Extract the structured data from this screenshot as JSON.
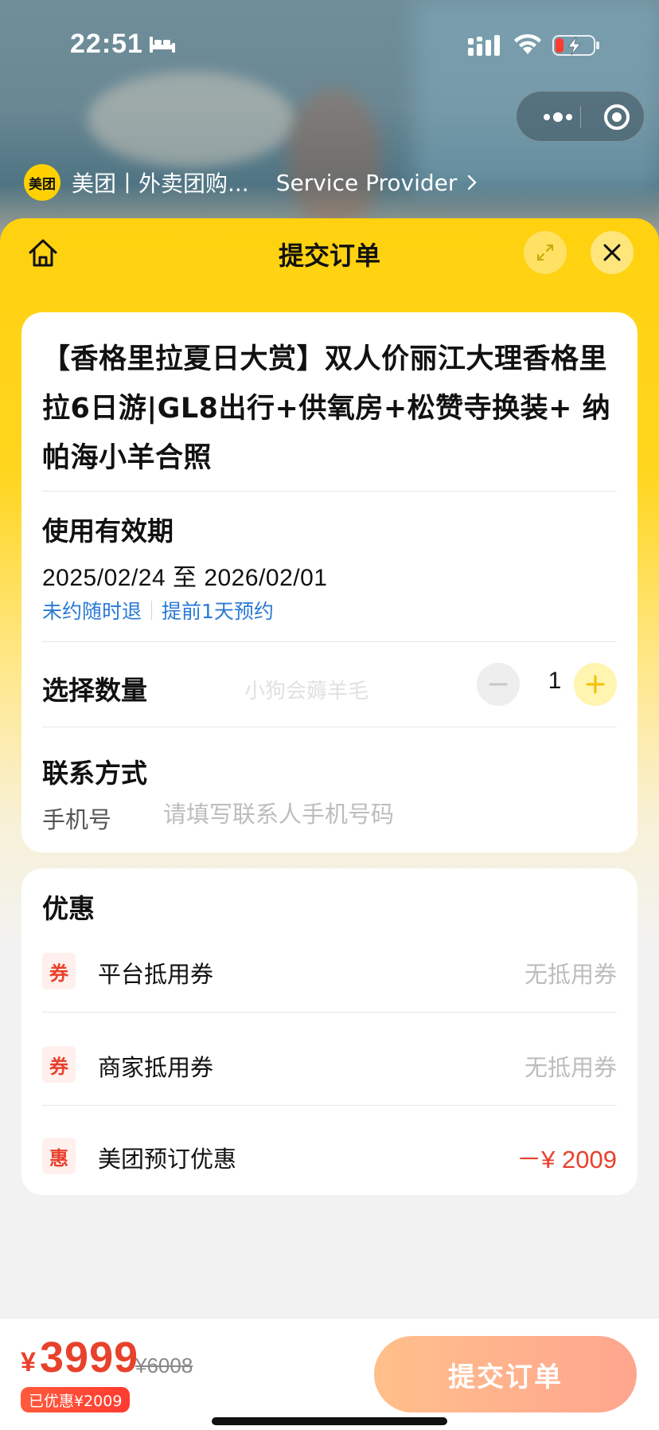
{
  "status_bar": {
    "time": "22:51"
  },
  "mini_program": {
    "logo_text": "美团",
    "name": "美团丨外卖团购...",
    "provider": "Service Provider"
  },
  "sheet": {
    "title": "提交订单"
  },
  "product": {
    "title": "【香格里拉夏日大赏】双人价丽江大理香格里拉6日游|GL8出行+供氧房+松赞寺换装+ 纳帕海小羊合照"
  },
  "validity": {
    "label": "使用有效期",
    "range": "2025/02/24 至 2026/02/01",
    "policy_refund": "未约随时退",
    "policy_booking": "提前1天预约"
  },
  "quantity": {
    "label": "选择数量",
    "value": "1",
    "watermark": "小狗会薅羊毛"
  },
  "contact": {
    "label": "联系方式",
    "phone_label": "手机号",
    "phone_value": "",
    "phone_placeholder": "请填写联系人手机号码"
  },
  "promotions": {
    "title": "优惠",
    "items": [
      {
        "badge": "券",
        "label": "平台抵用券",
        "value": "无抵用券"
      },
      {
        "badge": "券",
        "label": "商家抵用券",
        "value": "无抵用券"
      },
      {
        "badge": "惠",
        "label": "美团预订优惠",
        "value": "－¥ 2009"
      }
    ]
  },
  "bottom": {
    "currency": "¥",
    "price": "3999",
    "original_price": "¥6008",
    "discount_text": "已优惠¥2009",
    "submit_label": "提交订单"
  },
  "colors": {
    "brand_yellow": "#ffd100",
    "price_red": "#e8412c",
    "link_blue": "#2a7ad6",
    "submit_gradient_start": "#ffbf8a",
    "submit_gradient_end": "#ffa58f"
  },
  "icons": {
    "status": [
      "bed-icon",
      "signal-icon",
      "wifi-icon",
      "battery-charging-icon"
    ],
    "capsule": [
      "more-icon",
      "target-icon"
    ],
    "header": [
      "home-icon",
      "expand-icon",
      "close-icon"
    ],
    "quantity": [
      "minus-icon",
      "plus-icon"
    ]
  }
}
